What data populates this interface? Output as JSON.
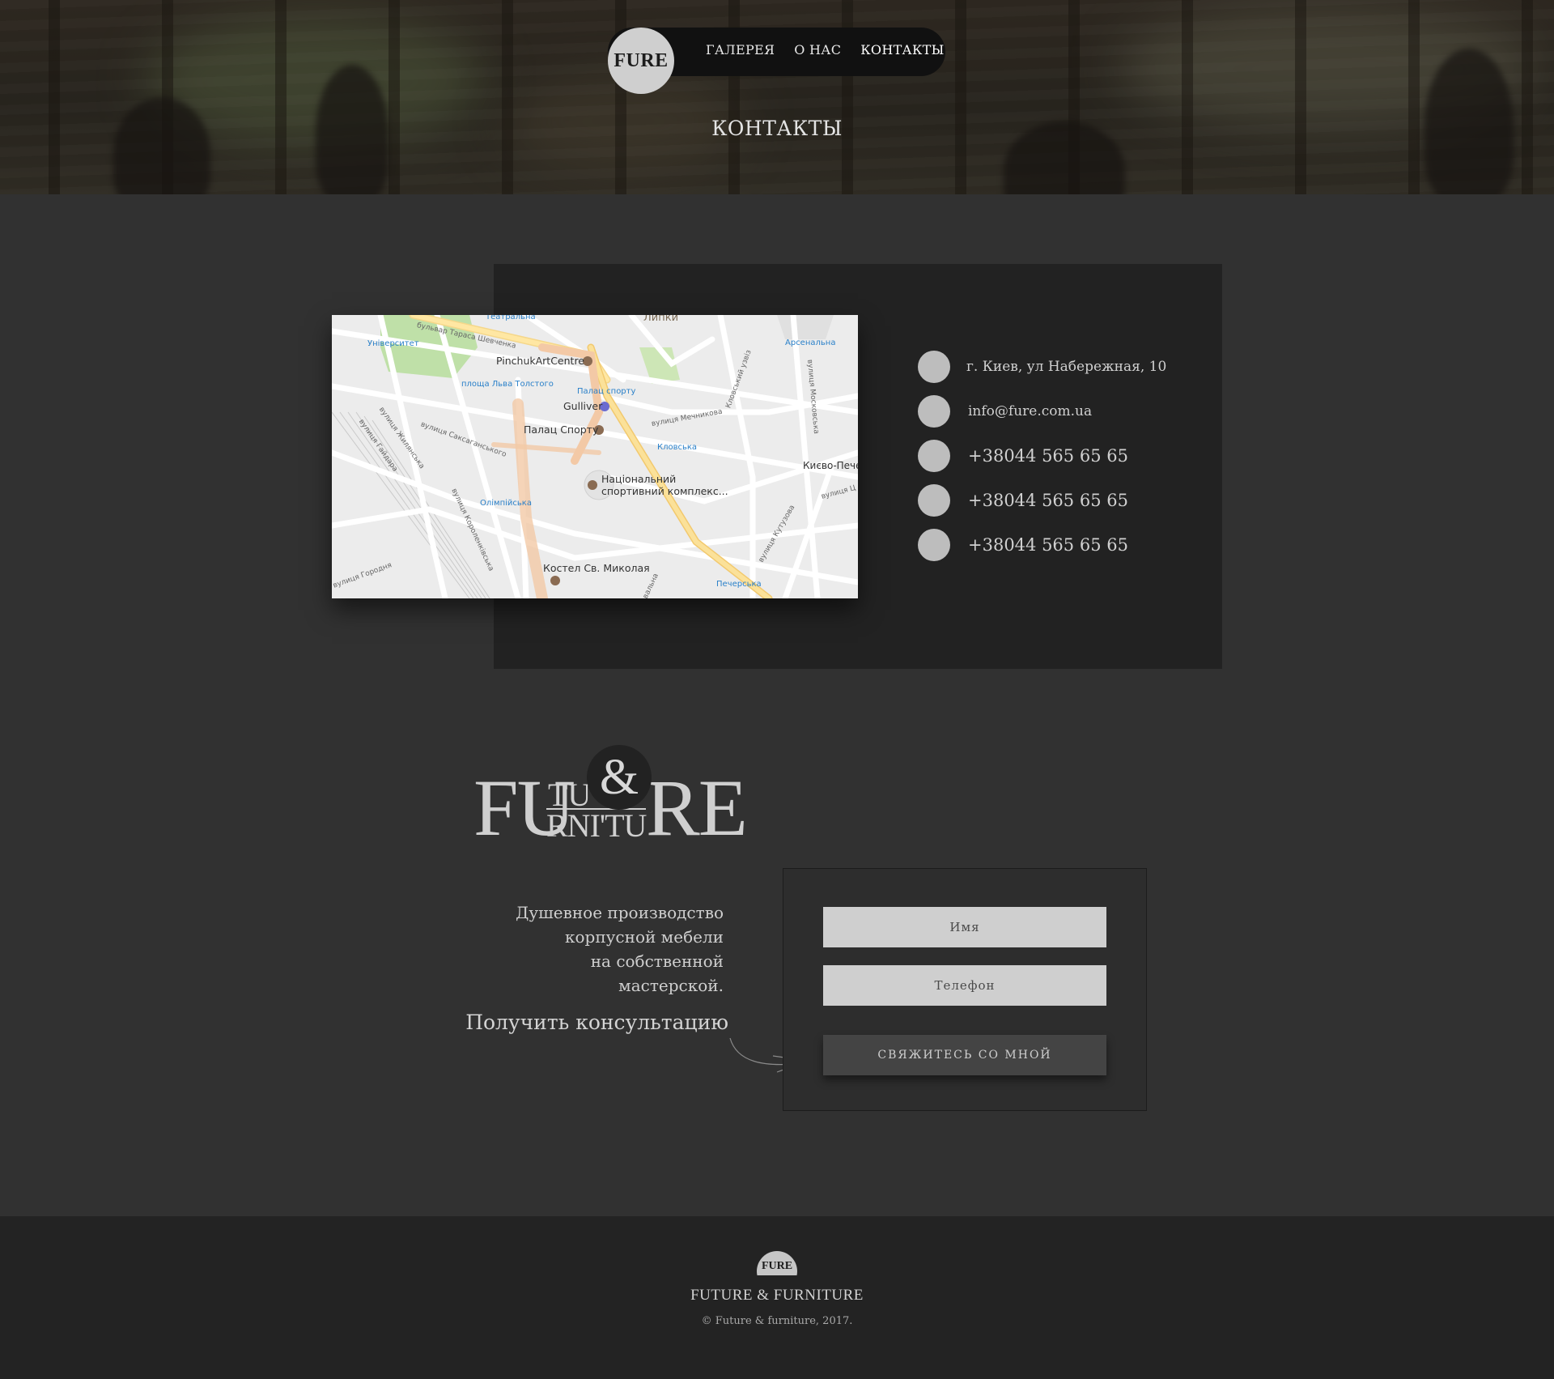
{
  "nav": {
    "logo": "FURE",
    "links": [
      "ГАЛЕРЕЯ",
      "О НАС",
      "КОНТАКТЫ"
    ]
  },
  "hero": {
    "title": "КОНТАКТЫ"
  },
  "map": {
    "labels": {
      "teatralna": "Театральна",
      "shevchenka": "бульвар Тараса Шевченка",
      "lypky": "Липки",
      "universytet": "Університет",
      "arsenalna": "Арсенальна",
      "pinchuk": "PinchukArtCentre",
      "tolstogo": "площа Льва Толстого",
      "palats_sportu_metro": "Палац спорту",
      "gulliver": "Gulliver",
      "palats_sportu": "Палац Спорту",
      "mechnykova": "вулиця Мечникова",
      "klovska": "Кловська",
      "klovskyi_uzviz": "Кловський узвіз",
      "moskovska": "вулиця Московська",
      "kyievo_pech": "Києво-Пече",
      "saksahanskoho": "вулиця Саксаганського",
      "natsionalnyi": "Національний",
      "sportyvnyi": "спортивний комплекс...",
      "zhylianska": "вулиця Жилянська",
      "haidara": "вулиця Гайдара",
      "olimpiiska": "Олімпійська",
      "chervonoarmiiska": "вулиця Короленківська",
      "kutuzova": "вулиця Кутузова",
      "kostel": "Костел Св. Миколая",
      "horodnia": "вулиця Городня",
      "pecherska": "Печерська",
      "tsyt": "вулиця Ц",
      "voval": "овальна"
    }
  },
  "contacts": {
    "address": "г. Киев, ул Набережная, 10",
    "email": "info@fure.com.ua",
    "phones": [
      "+38044 565 65 65",
      "+38044 565 65 65",
      "+38044 565 65 65"
    ]
  },
  "logo_block": {
    "fu": "FU",
    "tu": "TU",
    "amp": "&",
    "rni": "RNI'TU",
    "re": "RE"
  },
  "tagline": {
    "lines": [
      "Душевное производство",
      "корпусной мебели",
      "на собственной",
      "мастерской."
    ],
    "consult": "Получить консультацию"
  },
  "form": {
    "name_placeholder": "Имя",
    "phone_placeholder": "Телефон",
    "submit_label": "СВЯЖИТЕСЬ СО МНОЙ"
  },
  "footer": {
    "logo": "FURE",
    "name": "FUTURE & FURNITURE",
    "copyright": "© Future & furniture, 2017."
  },
  "colors": {
    "page_bg": "#313131",
    "panel_bg": "#222222",
    "footer_bg": "#232323",
    "accent_gray": "#cfcfcf"
  }
}
